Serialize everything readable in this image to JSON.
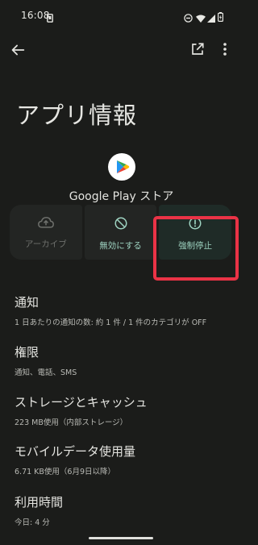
{
  "status": {
    "time": "16:08"
  },
  "page": {
    "title": "アプリ情報"
  },
  "app": {
    "name": "Google Play ストア"
  },
  "actions": [
    {
      "label": "アーカイブ",
      "enabled": false
    },
    {
      "label": "無効にする",
      "enabled": true
    },
    {
      "label": "強制停止",
      "enabled": true,
      "highlighted": true
    }
  ],
  "items": [
    {
      "title": "通知",
      "subtitle": "1 日あたりの通知の数: 約 1 件 / 1 件のカテゴリが OFF"
    },
    {
      "title": "権限",
      "subtitle": "通知、電話、SMS"
    },
    {
      "title": "ストレージとキャッシュ",
      "subtitle": "223 MB使用（内部ストレージ）"
    },
    {
      "title": "モバイルデータ使用量",
      "subtitle": "6.71 KB使用（6月9日以降）"
    },
    {
      "title": "利用時間",
      "subtitle": "今日: 4 分"
    }
  ],
  "colors": {
    "accent": "#9fd4c2",
    "highlight": "#ea3346",
    "background": "#1b1c1a"
  }
}
